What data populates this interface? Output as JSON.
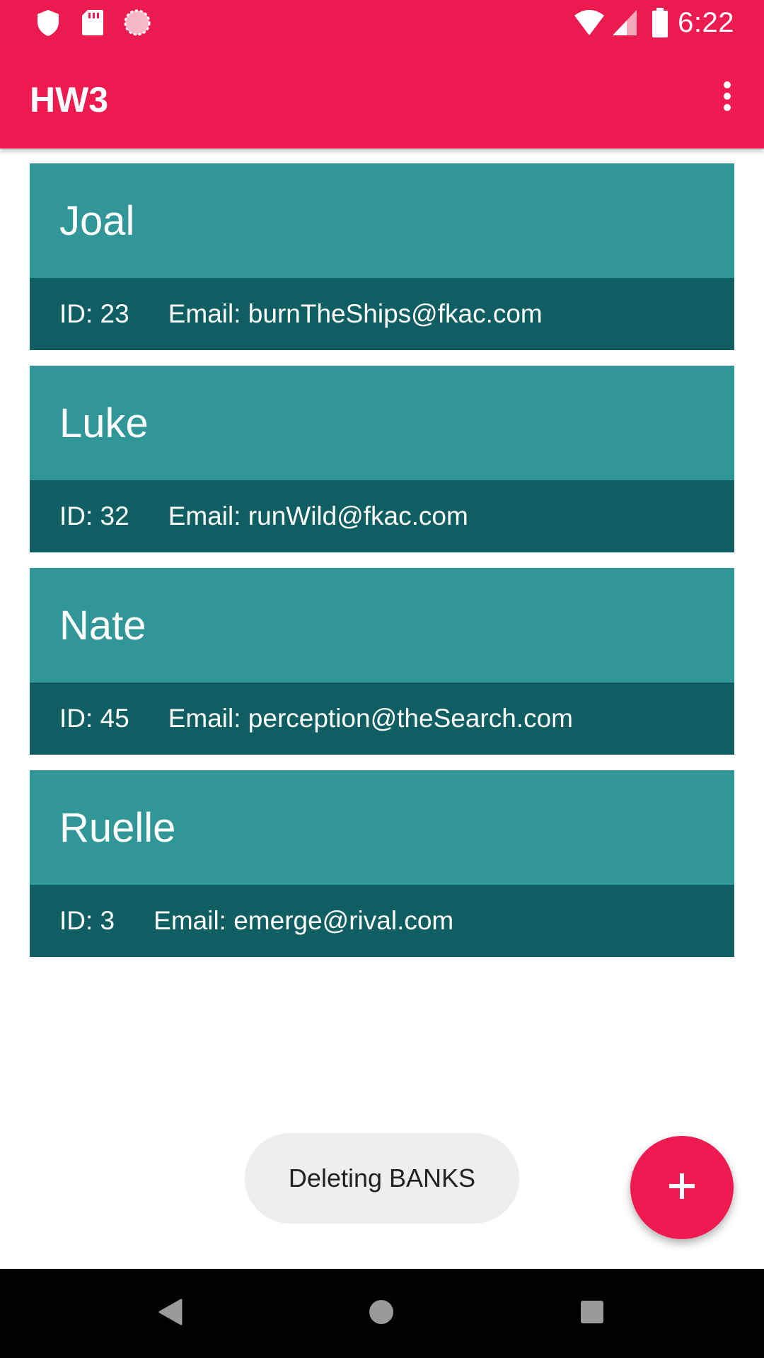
{
  "status_bar": {
    "time": "6:22",
    "left_icons": [
      "shield-icon",
      "sd-card-icon",
      "sync-icon"
    ],
    "right_icons": [
      "wifi-icon",
      "cell-signal-icon",
      "battery-icon"
    ]
  },
  "app_bar": {
    "title": "HW3",
    "overflow_icon": "more-vert-icon"
  },
  "contacts": [
    {
      "name": "Joal",
      "id": "ID: 23",
      "email": "Email: burnTheShips@fkac.com"
    },
    {
      "name": "Luke",
      "id": "ID: 32",
      "email": "Email: runWild@fkac.com"
    },
    {
      "name": "Nate",
      "id": "ID: 45",
      "email": "Email: perception@theSearch.com"
    },
    {
      "name": "Ruelle",
      "id": "ID: 3",
      "email": "Email: emerge@rival.com"
    }
  ],
  "toast": {
    "message": "Deleting BANKS"
  },
  "fab": {
    "icon": "plus-icon"
  },
  "nav_bar": {
    "icons": [
      "back-icon",
      "home-icon",
      "recents-icon"
    ]
  },
  "colors": {
    "accent": "#EF1B50",
    "card_header": "#309697",
    "card_footer": "#0E5E62",
    "toast_bg": "#EEEEEE"
  }
}
